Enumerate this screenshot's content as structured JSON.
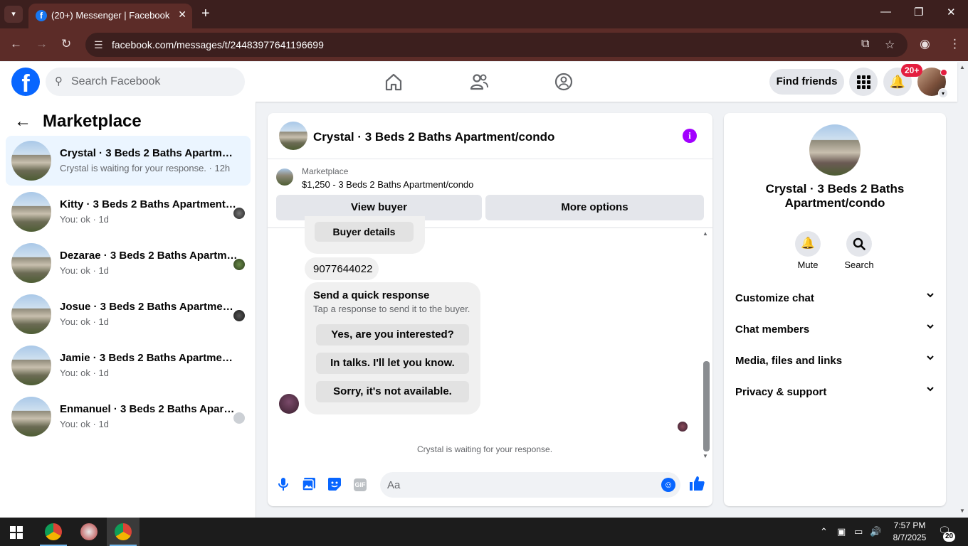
{
  "browser": {
    "tab_title": "(20+) Messenger | Facebook",
    "url": "facebook.com/messages/t/24483977641196699"
  },
  "fb_nav": {
    "search_placeholder": "Search Facebook",
    "find_friends_label": "Find friends",
    "notifications_badge": "20+"
  },
  "left_panel": {
    "title": "Marketplace",
    "threads": [
      {
        "name": "Crystal · 3 Beds 2 Baths Apartment/condo",
        "preview": "Crystal is waiting for your response. · 12h",
        "active": true
      },
      {
        "name": "Kitty · 3 Beds 2 Baths Apartment/condo",
        "preview": "You: ok · 1d",
        "active": false
      },
      {
        "name": "Dezarae · 3 Beds 2 Baths Apartment/condo",
        "preview": "You: ok · 1d",
        "active": false
      },
      {
        "name": "Josue · 3 Beds 2 Baths Apartment/condo",
        "preview": "You: ok · 1d",
        "active": false
      },
      {
        "name": "Jamie · 3 Beds 2 Baths Apartment/condo",
        "preview": "You: ok · 1d",
        "active": false
      },
      {
        "name": "Enmanuel · 3 Beds 2 Baths Apartment/condo",
        "preview": "You: ok · 1d",
        "active": false
      }
    ]
  },
  "chat": {
    "title": "Crystal · 3 Beds 2 Baths Apartment/condo",
    "marketplace_label": "Marketplace",
    "listing": "$1,250 - 3 Beds 2 Baths Apartment/condo",
    "view_buyer_label": "View buyer",
    "more_options_label": "More options",
    "buyer_details_label": "Buyer details",
    "phone_message": "9077644022",
    "quick_response_title": "Send a quick response",
    "quick_response_hint": "Tap a response to send it to the buyer.",
    "quick_responses": [
      "Yes, are you interested?",
      "In talks. I'll let you know.",
      "Sorry, it's not available."
    ],
    "waiting_text": "Crystal is waiting for your response.",
    "composer_placeholder": "Aa",
    "gif_label": "GIF"
  },
  "right_panel": {
    "name": "Crystal · 3 Beds 2 Baths Apartment/condo",
    "mute_label": "Mute",
    "search_label": "Search",
    "sections": [
      "Customize chat",
      "Chat members",
      "Media, files and links",
      "Privacy & support"
    ]
  },
  "taskbar": {
    "time": "7:57 PM",
    "date": "8/7/2025",
    "notification_count": "20"
  }
}
